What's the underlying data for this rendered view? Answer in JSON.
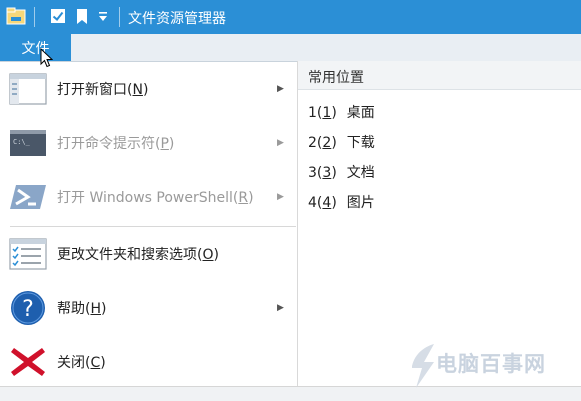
{
  "titlebar": {
    "title": "文件资源管理器",
    "icons": [
      "folder-icon",
      "checkbox-icon",
      "bookmark-icon",
      "dropdown-icon"
    ]
  },
  "ribbon": {
    "file_tab": "文件"
  },
  "menu": {
    "items": [
      {
        "label": "打开新窗口",
        "key": "N",
        "enabled": true,
        "has_submenu": true,
        "icon": "window-icon"
      },
      {
        "label": "打开命令提示符",
        "key": "P",
        "enabled": false,
        "has_submenu": true,
        "icon": "command-prompt-icon"
      },
      {
        "label": "打开 Windows PowerShell",
        "key": "R",
        "enabled": false,
        "has_submenu": true,
        "icon": "powershell-icon"
      },
      {
        "label": "更改文件夹和搜索选项",
        "key": "O",
        "enabled": true,
        "has_submenu": false,
        "icon": "options-icon"
      },
      {
        "label": "帮助",
        "key": "H",
        "enabled": true,
        "has_submenu": true,
        "icon": "help-icon"
      },
      {
        "label": "关闭",
        "key": "C",
        "enabled": true,
        "has_submenu": false,
        "icon": "close-icon"
      }
    ]
  },
  "recent": {
    "header": "常用位置",
    "items": [
      {
        "num": "1",
        "key": "1",
        "name": "桌面"
      },
      {
        "num": "2",
        "key": "2",
        "name": "下载"
      },
      {
        "num": "3",
        "key": "3",
        "name": "文档"
      },
      {
        "num": "4",
        "key": "4",
        "name": "图片"
      }
    ]
  },
  "watermark": {
    "text": "电脑百事网"
  },
  "colors": {
    "accent": "#2b8fd6",
    "tab_strip": "#e9eef3",
    "disabled_text": "#9a9a9a",
    "close_red": "#d0112b",
    "help_blue": "#1e5fae"
  }
}
